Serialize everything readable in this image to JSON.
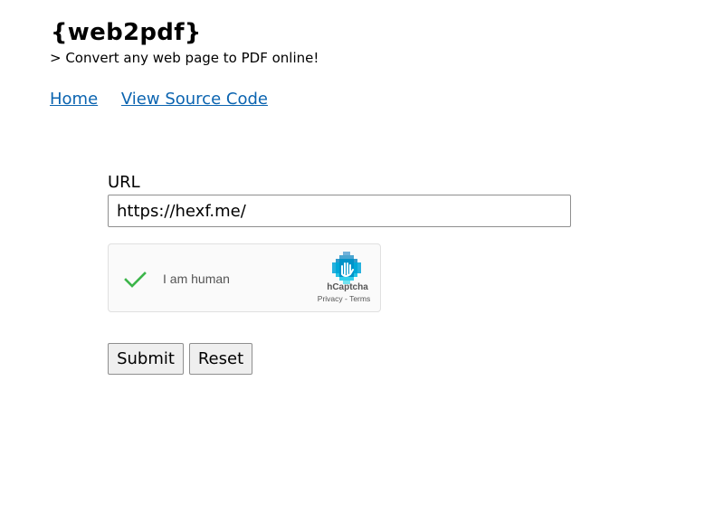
{
  "header": {
    "site_title": "{web2pdf}",
    "tagline": "> Convert any web page to PDF online!"
  },
  "nav": {
    "home": "Home",
    "view_source": "View Source Code"
  },
  "form": {
    "url_label": "URL",
    "url_value": "https://hexf.me/",
    "captcha": {
      "label": "I am human",
      "brand": "hCaptcha",
      "privacy": "Privacy",
      "separator": " - ",
      "terms": "Terms",
      "checked": true,
      "check_icon": "checkmark-icon",
      "logo_icon": "hcaptcha-logo-icon",
      "check_color": "#3cb54a"
    },
    "submit_label": "Submit",
    "reset_label": "Reset"
  },
  "colors": {
    "link": "#0b64b0",
    "button_bg": "#efefef",
    "captcha_bg": "#fafafa"
  }
}
